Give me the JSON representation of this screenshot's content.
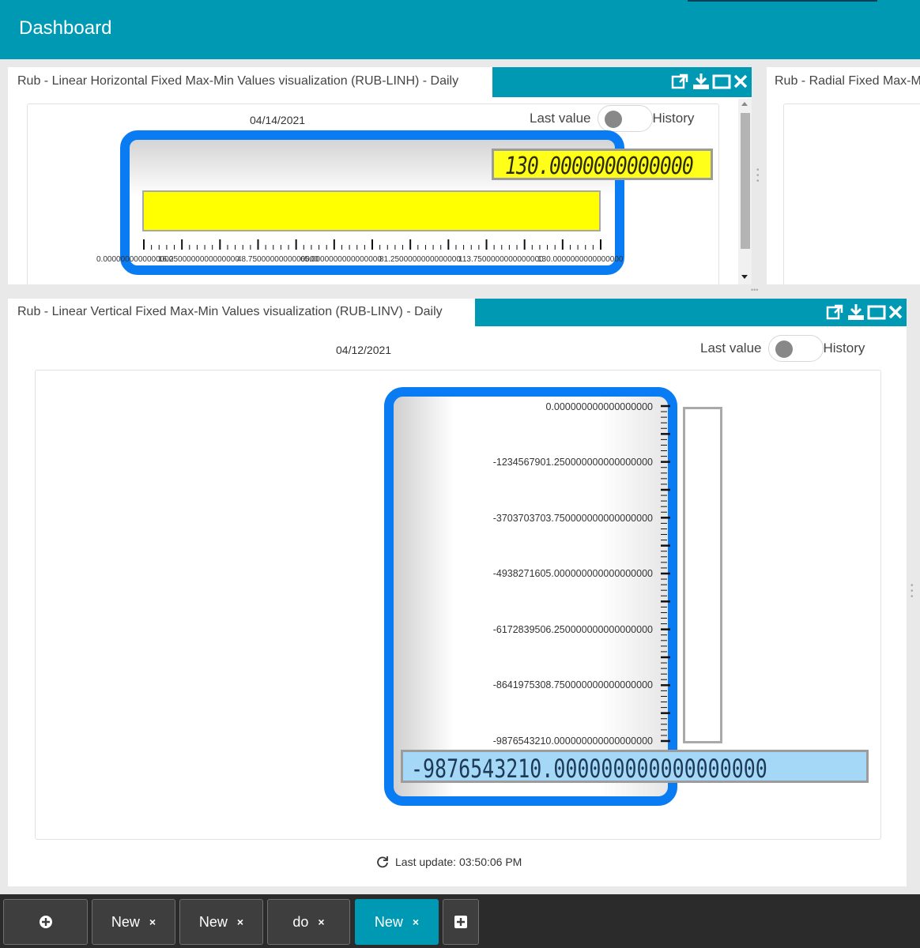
{
  "header": {
    "title": "Dashboard"
  },
  "widget_top_left": {
    "title": "Rub - Linear Horizontal Fixed Max-Min Values visualization (RUB-LINH) - Daily",
    "date": "04/14/2021",
    "toggle_left": "Last value",
    "toggle_right": "History",
    "lcd_value": "130.0000000000000",
    "bar_fill_fraction": 1.0,
    "scale_labels": [
      "0.0000000000000000",
      "16.2500000000000000",
      "48.7500000000000000",
      "65.0000000000000000",
      "81.2500000000000000",
      "113.7500000000000000",
      "130.0000000000000000"
    ],
    "colors": {
      "bar": "#ffff00",
      "frame": "#0a7cf3",
      "lcd": "#ffff1a"
    }
  },
  "widget_top_right": {
    "title": "Rub - Radial Fixed Max-Min Values visualization"
  },
  "widget_bottom": {
    "title": "Rub - Linear Vertical Fixed Max-Min Values visualization (RUB-LINV) - Daily",
    "date": "04/12/2021",
    "toggle_left": "Last value",
    "toggle_right": "History",
    "scale_labels": [
      "0.000000000000000000",
      "-1234567901.250000000000000000",
      "-3703703703.750000000000000000",
      "-4938271605.000000000000000000",
      "-6172839506.250000000000000000",
      "-8641975308.750000000000000000",
      "-9876543210.000000000000000000"
    ],
    "lcd_value": "-9876543210.000000000000000000",
    "last_update": "Last update: 03:50:06 PM",
    "colors": {
      "frame": "#0a7cf3",
      "lcd": "#a5d7f7"
    }
  },
  "widget_icons": [
    "open-external-icon",
    "download-icon",
    "maximize-icon",
    "close-icon"
  ],
  "taskbar": {
    "tabs": [
      {
        "label": "New",
        "active": false
      },
      {
        "label": "New",
        "active": false
      },
      {
        "label": "do",
        "active": false
      },
      {
        "label": "New",
        "active": true
      }
    ],
    "close_glyph": "×"
  },
  "theme": {
    "accent": "#0099b4",
    "taskbar_bg": "#2b2b2b"
  }
}
